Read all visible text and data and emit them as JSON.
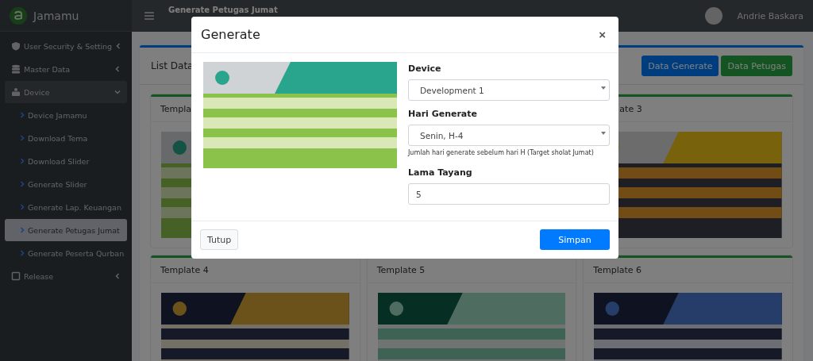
{
  "brand": {
    "name": "Jamamu"
  },
  "topbar": {
    "page_title": "Generate Petugas Jumat",
    "user": "Andrie Baskara"
  },
  "sidebar": {
    "items": [
      {
        "label": "User Security & Setting",
        "kind": "shield",
        "expanded": false
      },
      {
        "label": "Master Data",
        "kind": "database",
        "expanded": false
      },
      {
        "label": "Device",
        "kind": "users",
        "expanded": true,
        "children": [
          {
            "label": "Device Jamamu",
            "selected": false
          },
          {
            "label": "Download Tema",
            "selected": false
          },
          {
            "label": "Download Slider",
            "selected": false
          },
          {
            "label": "Generate Slider",
            "selected": false
          },
          {
            "label": "Generate Lap. Keuangan",
            "selected": false
          },
          {
            "label": "Generate Petugas Jumat",
            "selected": true
          },
          {
            "label": "Generate Peserta Qurban",
            "selected": false
          }
        ]
      },
      {
        "label": "Release",
        "kind": "tablet",
        "expanded": false
      }
    ]
  },
  "content": {
    "card_title": "List Data",
    "buttons": [
      {
        "label": "Data Generate",
        "kind": "primary"
      },
      {
        "label": "Data Petugas",
        "kind": "success"
      }
    ],
    "templates": [
      {
        "title": "Templa",
        "kind": "green"
      },
      {
        "title": "ate 3",
        "kind": "yellow",
        "cut_left": true
      },
      {
        "title": "Template 4",
        "kind": "gold"
      },
      {
        "title": "Template 5",
        "kind": "teal"
      },
      {
        "title": "Template 6",
        "kind": "blue"
      }
    ]
  },
  "modal": {
    "title": "Generate",
    "close": "×",
    "fields": [
      {
        "kind": "select",
        "label": "Device",
        "value": "Development 1"
      },
      {
        "kind": "select",
        "label": "Hari Generate",
        "value": "Senin, H-4",
        "help": "Jumlah hari generate sebelum hari H (Target sholat Jumat)"
      },
      {
        "kind": "input",
        "label": "Lama Tayang",
        "value": "5"
      }
    ],
    "buttons": [
      {
        "label": "Tutup",
        "kind": "secondary"
      },
      {
        "label": "Simpan",
        "kind": "primary"
      }
    ]
  }
}
